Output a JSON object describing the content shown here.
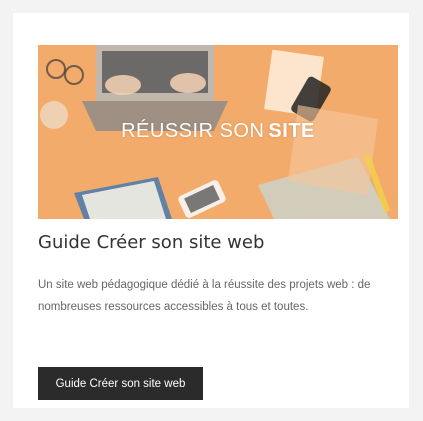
{
  "banner": {
    "title_light": "RÉUSSIR SON",
    "title_bold": "SITE"
  },
  "card": {
    "title": "Guide Créer son site web",
    "description": "Un site web pédagogique dédié à la réussite des projets web : de nombreuses ressources accessibles à tous et toutes.",
    "button_label": "Guide Créer son site web"
  },
  "colors": {
    "banner_orange": "#f0a15b",
    "button_bg": "#2b2b2b",
    "text_dark": "#333333",
    "text_muted": "#666666"
  }
}
